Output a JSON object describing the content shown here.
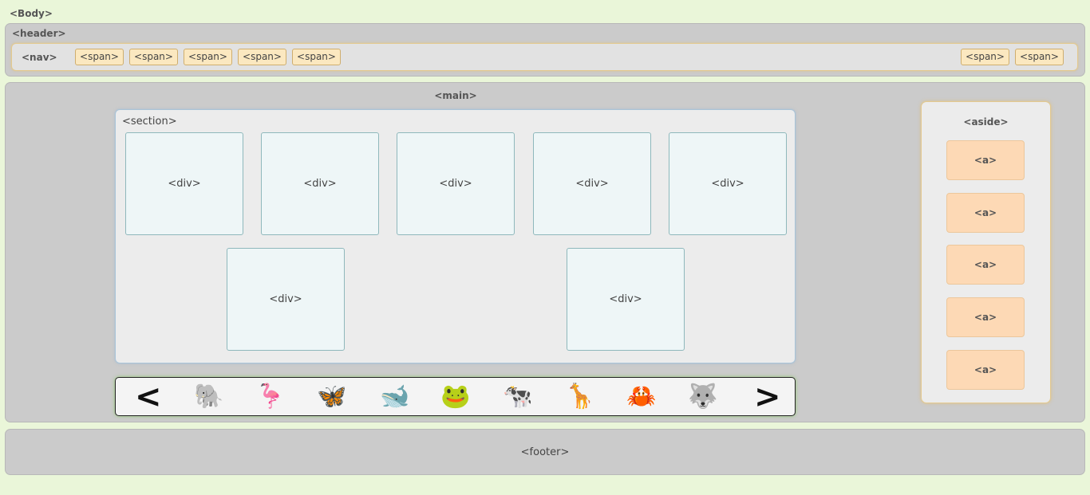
{
  "body": {
    "label": "<Body>"
  },
  "header": {
    "label": "<header>",
    "nav": {
      "label": "<nav>",
      "left_spans": [
        "<span>",
        "<span>",
        "<span>",
        "<span>",
        "<span>"
      ],
      "right_spans": [
        "<span>",
        "<span>"
      ]
    }
  },
  "main": {
    "label": "<main>",
    "section": {
      "label": "<section>",
      "divs": [
        "<div>",
        "<div>",
        "<div>",
        "<div>",
        "<div>",
        "<div>",
        "<div>"
      ]
    },
    "carousel": {
      "prev": "<",
      "next": ">",
      "animals": [
        "🐘",
        "🦩",
        "🦋",
        "🐋",
        "🐸",
        "🐄",
        "🦒",
        "🦀",
        "🐺"
      ],
      "border_color": "#222222",
      "glow_color": "#82c85a"
    },
    "aside": {
      "label": "<aside>",
      "links": [
        "<a>",
        "<a>",
        "<a>",
        "<a>",
        "<a>"
      ]
    }
  },
  "footer": {
    "label": "<footer>"
  },
  "colors": {
    "page_bg": "#eaf6d9",
    "panel_bg": "#cbcbcb",
    "span_bg": "#fbe8c0",
    "link_bg": "#fdd9b5",
    "div_bg": "#eef6f7"
  }
}
